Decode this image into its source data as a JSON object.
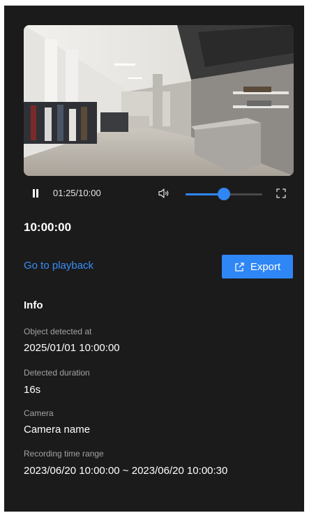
{
  "player": {
    "current_time": "01:25/10:00",
    "volume_level": 0.5,
    "accent_color": "#2f86f5"
  },
  "clip": {
    "timestamp": "10:00:00"
  },
  "actions": {
    "playback_link": "Go to playback",
    "export_label": "Export"
  },
  "info": {
    "title": "Info",
    "fields": [
      {
        "label": "Object detected at",
        "value": "2025/01/01 10:00:00"
      },
      {
        "label": "Detected duration",
        "value": "16s"
      },
      {
        "label": "Camera",
        "value": "Camera name"
      },
      {
        "label": "Recording time range",
        "value": "2023/06/20 10:00:00 ~ 2023/06/20 10:00:30"
      }
    ]
  },
  "icons": {
    "play_state": "pause-icon",
    "volume": "volume-icon",
    "fullscreen": "fullscreen-icon",
    "export": "export-icon"
  }
}
